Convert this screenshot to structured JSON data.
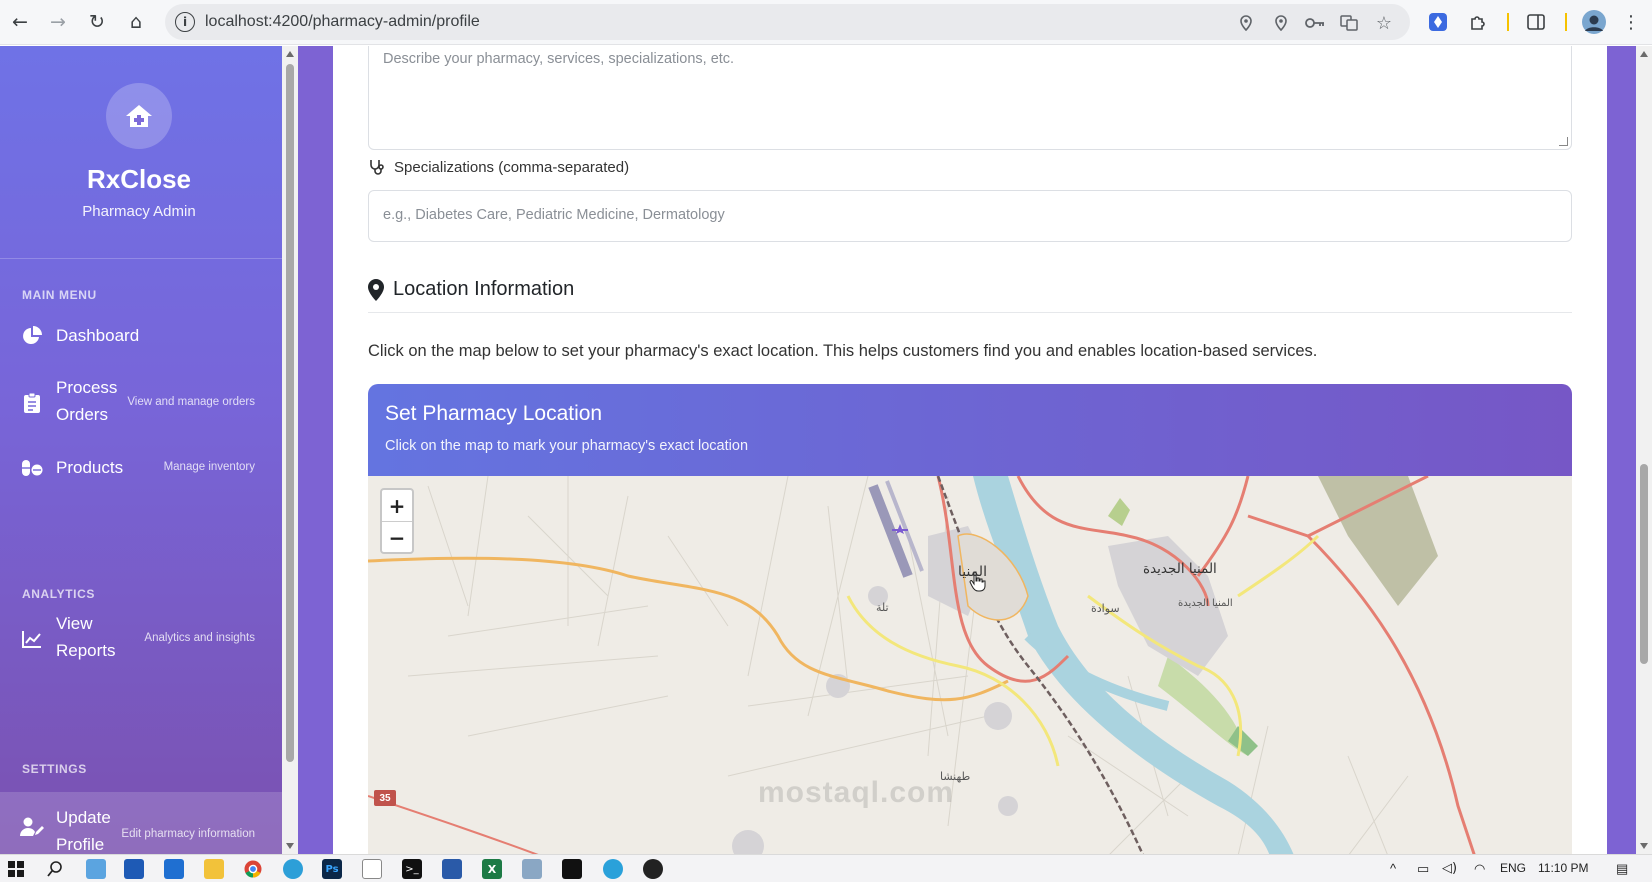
{
  "browser": {
    "url": "localhost:4200/pharmacy-admin/profile",
    "nav": {
      "back": "←",
      "forward": "→",
      "reload": "↻",
      "home": "⌂"
    }
  },
  "sidebar": {
    "brand": "RxClose",
    "brand_sub": "Pharmacy Admin",
    "sections": {
      "main_menu": "MAIN MENU",
      "analytics": "ANALYTICS",
      "settings": "SETTINGS"
    },
    "items": [
      {
        "label": "Dashboard",
        "desc": "",
        "icon": "pie-chart-icon"
      },
      {
        "label": "Process Orders",
        "desc": "View and manage orders",
        "icon": "clipboard-icon"
      },
      {
        "label": "Products",
        "desc": "Manage inventory",
        "icon": "pills-icon"
      },
      {
        "label": "View Reports",
        "desc": "Analytics and insights",
        "icon": "line-chart-icon"
      },
      {
        "label": "Update Profile",
        "desc": "Edit pharmacy information",
        "icon": "user-edit-icon",
        "active": true
      }
    ]
  },
  "form": {
    "description_placeholder": "Describe your pharmacy, services, specializations, etc.",
    "specializations_label": "Specializations (comma-separated)",
    "specializations_placeholder": "e.g., Diabetes Care, Pediatric Medicine, Dermatology"
  },
  "location": {
    "heading": "Location Information",
    "intro": "Click on the map below to set your pharmacy's exact location. This helps customers find you and enables location-based services.",
    "card_title": "Set Pharmacy Location",
    "card_subtitle": "Click on the map to mark your pharmacy's exact location",
    "zoom_in": "+",
    "zoom_out": "−",
    "map_labels": {
      "city": "المنيا",
      "new_city": "المنيا الجديدة",
      "new_city_small": "المنيا الجديدة",
      "sawada": "سوادة",
      "town1": "تلة",
      "town2": "طهنشا",
      "road": "35"
    },
    "watermark": "mostaql.com"
  },
  "taskbar": {
    "lang": "ENG",
    "time": "11:10 PM"
  }
}
